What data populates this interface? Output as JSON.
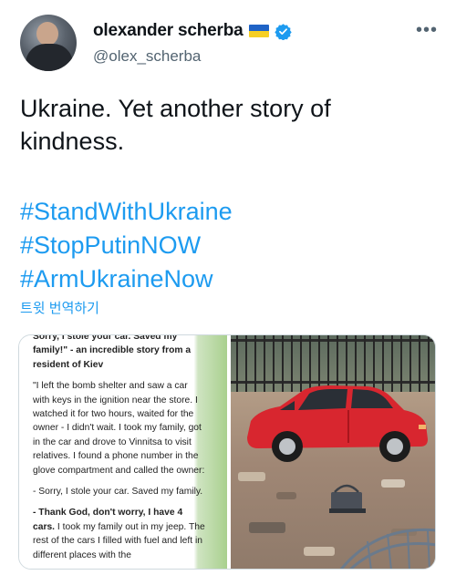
{
  "author": {
    "display_name": "olexander scherba",
    "handle": "@olex_scherba",
    "more_label": "•••"
  },
  "tweet": {
    "text": "Ukraine. Yet another story of kindness.",
    "hashtags": [
      "#StandWithUkraine",
      "#StopPutinNOW",
      "#ArmUkraineNow"
    ],
    "translate_label": "트윗 번역하기"
  },
  "media": {
    "story": {
      "cutoff_line": "Sorry, I stole your car. Saved my",
      "lead_bold": "family!\"",
      "lead_rest": " - an incredible story from a resident of Kiev",
      "p1": "\"I left the bomb shelter and saw a car with keys in the ignition near the store. I watched it for two hours, waited for the owner - I didn't wait. I took my family, got in the car and drove to Vinnitsa to visit relatives. I found a phone number in the glove compartment and called the owner:",
      "p2": "- Sorry, I stole your car. Saved my family.",
      "p3_bold": "- Thank God, don't worry, I have 4 cars.",
      "p3_rest": " I took my family out in my jeep. The rest of the cars I filled with fuel and left in different places with the"
    }
  },
  "colors": {
    "link": "#1d9bf0",
    "text": "#0f1419",
    "secondary": "#536471",
    "flag_blue": "#1f63c6",
    "flag_yellow": "#f6cf24",
    "car_red": "#d8262f"
  },
  "icons": {
    "verified": "verified-badge-icon",
    "flag": "ukraine-flag-icon",
    "more": "more-options-icon"
  }
}
